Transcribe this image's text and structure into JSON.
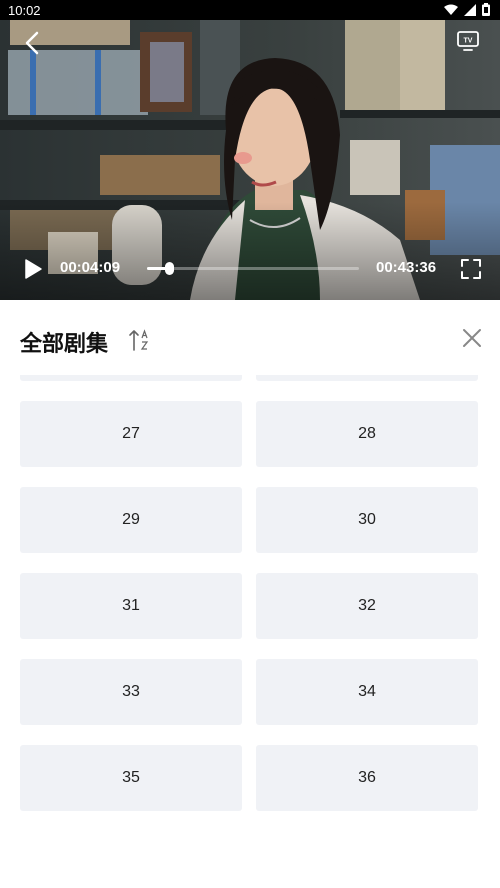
{
  "status_bar": {
    "time": "10:02",
    "icons": [
      "wifi-icon",
      "signal-icon",
      "battery-icon"
    ]
  },
  "player": {
    "current_time": "00:04:09",
    "total_time": "00:43:36",
    "progress": 0.095,
    "icons": [
      "back-arrow-icon",
      "tv-cast-icon",
      "play-icon",
      "fullscreen-icon"
    ]
  },
  "panel": {
    "title": "全部剧集",
    "sort_icon": "sort-az-icon",
    "close_icon": "close-icon"
  },
  "episodes": [
    "",
    "",
    "27",
    "28",
    "29",
    "30",
    "31",
    "32",
    "33",
    "34",
    "35",
    "36"
  ],
  "colors": {
    "tile_bg": "#f0f2f6",
    "status_bar_bg": "#000000"
  }
}
